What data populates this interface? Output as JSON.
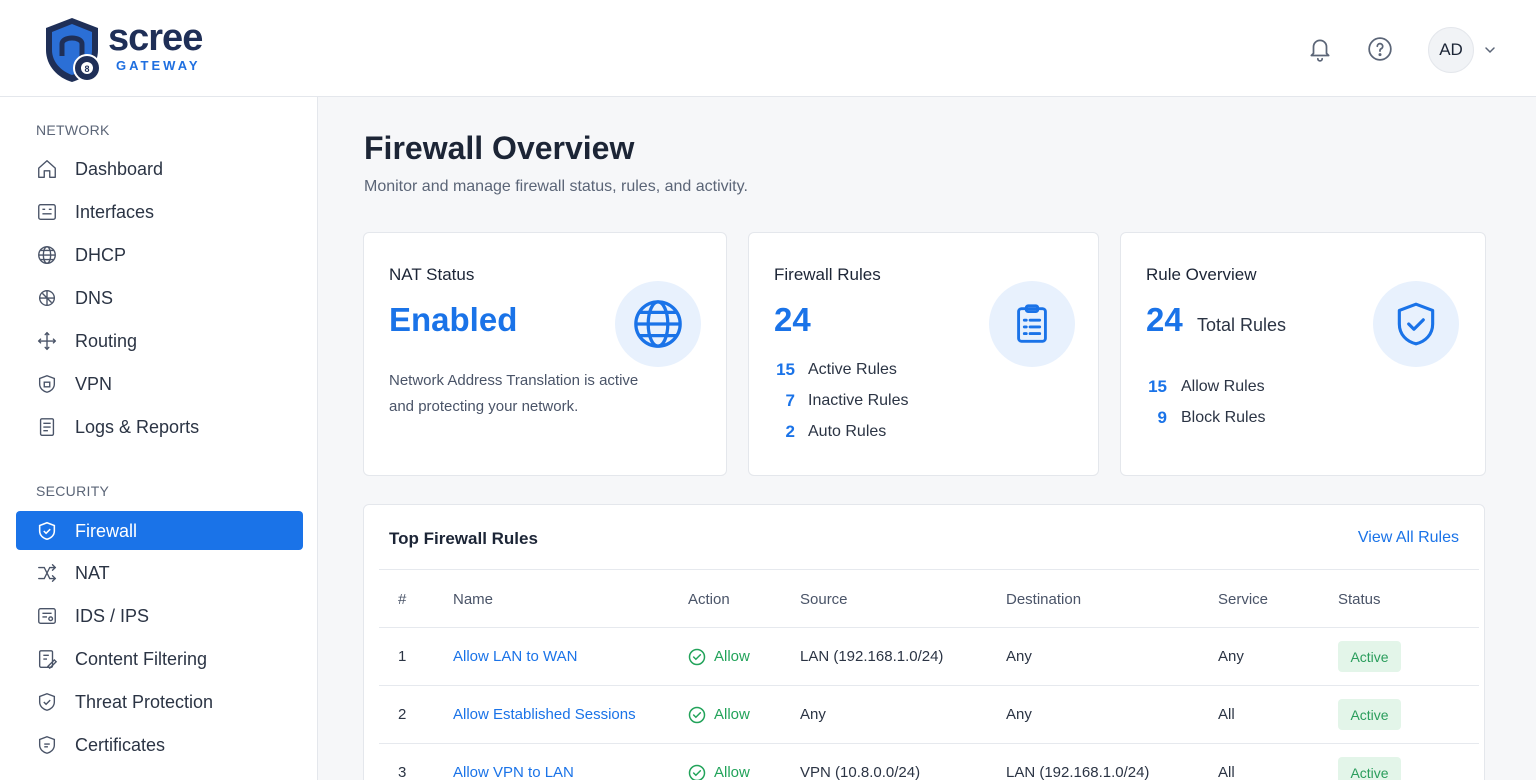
{
  "brand": {
    "name": "scree",
    "sub": "GATEWAY",
    "primary": "#1a73e8",
    "dark": "#1f2f57"
  },
  "header": {
    "icons": [
      "bell-icon",
      "help-icon",
      "chevron-down-icon"
    ],
    "avatar_initials": "AD"
  },
  "sidebar": {
    "network_label": "NETWORK",
    "network_items": [
      {
        "label": "Dashboard",
        "icon": "home-icon"
      },
      {
        "label": "Interfaces",
        "icon": "interfaces-icon"
      },
      {
        "label": "DHCP",
        "icon": "globe-icon"
      },
      {
        "label": "DNS",
        "icon": "dns-icon"
      },
      {
        "label": "Routing",
        "icon": "routing-icon"
      },
      {
        "label": "VPN",
        "icon": "vpn-shield-icon"
      },
      {
        "label": "Logs & Reports",
        "icon": "document-icon"
      }
    ],
    "security_label": "SECURITY",
    "security_items": [
      {
        "label": "Firewall",
        "icon": "shield-icon",
        "active": true
      },
      {
        "label": "NAT",
        "icon": "nat-icon"
      },
      {
        "label": "IDS / IPS",
        "icon": "ids-icon"
      },
      {
        "label": "Content Filtering",
        "icon": "filter-icon"
      },
      {
        "label": "Threat Protection",
        "icon": "shield-check-icon"
      },
      {
        "label": "Certificates",
        "icon": "certificate-icon"
      }
    ]
  },
  "page": {
    "title": "Firewall Overview",
    "subtitle": "Monitor and manage firewall status, rules, and activity."
  },
  "cards": {
    "nat": {
      "title": "NAT Status",
      "value": "Enabled",
      "desc_line1": "Network Address Translation is active",
      "desc_line2": "and protecting your network.",
      "icon": "globe-icon"
    },
    "rules": {
      "title": "Firewall Rules",
      "value": "24",
      "stats": [
        {
          "num": "15",
          "label": "Active Rules"
        },
        {
          "num": "7",
          "label": "Inactive Rules"
        },
        {
          "num": "2",
          "label": "Auto Rules"
        }
      ],
      "icon": "clipboard-icon"
    },
    "overview": {
      "title": "Rule Overview",
      "value": "24",
      "value_label": "Total Rules",
      "stats": [
        {
          "num": "15",
          "label": "Allow Rules"
        },
        {
          "num": "9",
          "label": "Block Rules"
        }
      ],
      "icon": "shield-check-icon"
    }
  },
  "table": {
    "title": "Top Firewall Rules",
    "link": "View All Rules",
    "headers": [
      "#",
      "Name",
      "Action",
      "Source",
      "Destination",
      "Service",
      "Status"
    ],
    "rows": [
      {
        "num": "1",
        "name": "Allow LAN to WAN",
        "action": "Allow",
        "source": "LAN (192.168.1.0/24)",
        "destination": "Any",
        "service": "Any",
        "status": "Active"
      },
      {
        "num": "2",
        "name": "Allow Established Sessions",
        "action": "Allow",
        "source": "Any",
        "destination": "Any",
        "service": "All",
        "status": "Active"
      },
      {
        "num": "3",
        "name": "Allow VPN to LAN",
        "action": "Allow",
        "source": "VPN (10.8.0.0/24)",
        "destination": "LAN (192.168.1.0/24)",
        "service": "All",
        "status": "Active"
      }
    ]
  }
}
